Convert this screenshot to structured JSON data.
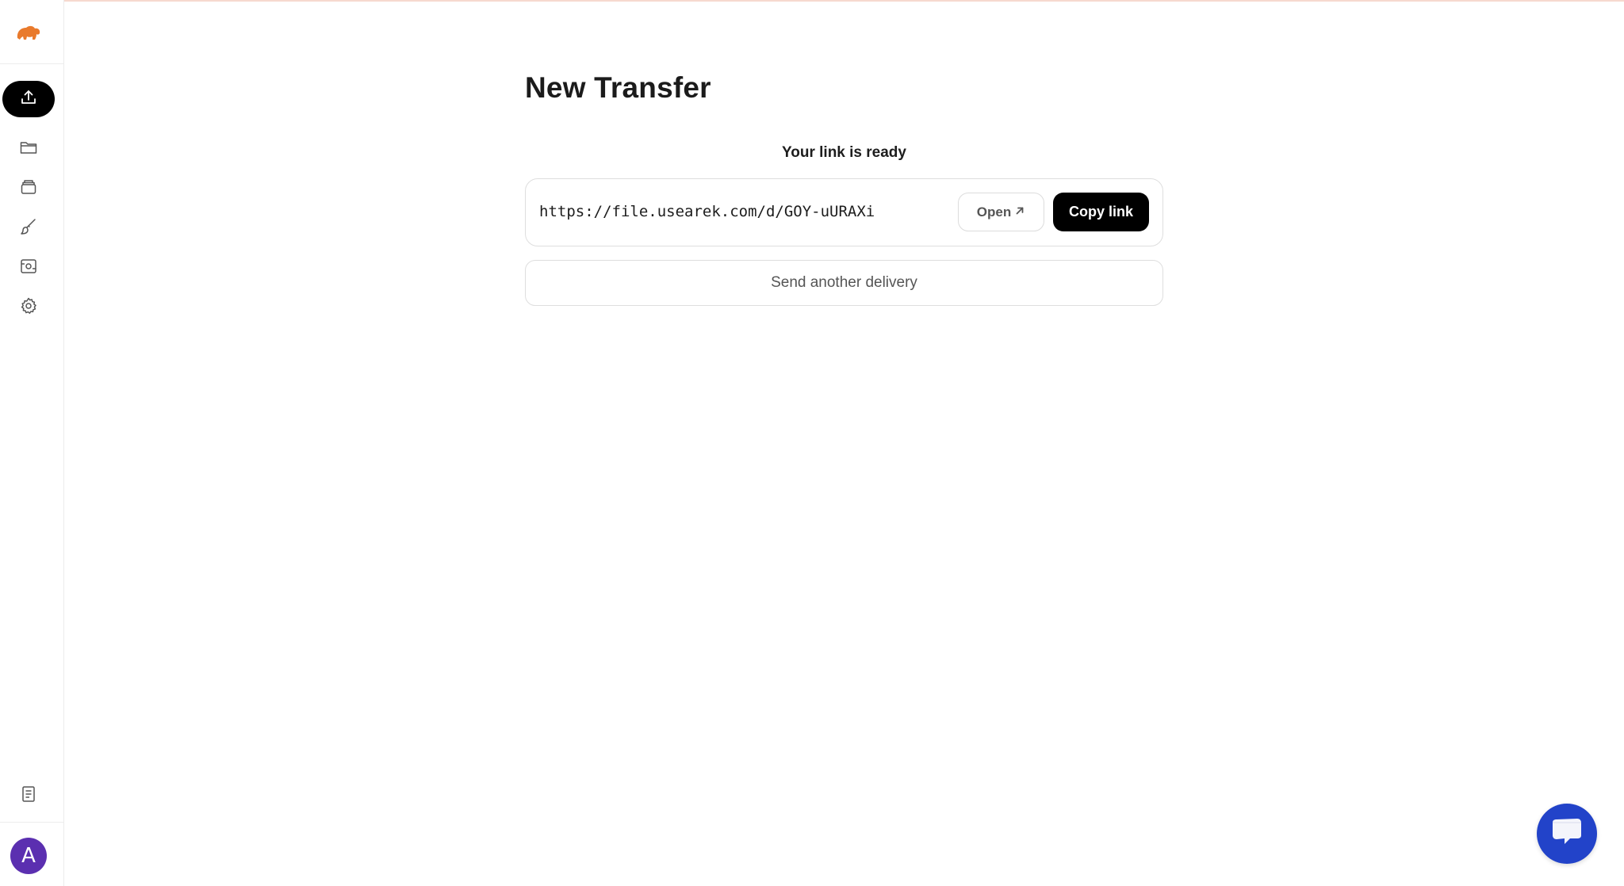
{
  "sidebar": {
    "logo": "elephant-logo",
    "items": [
      {
        "name": "upload",
        "icon": "upload-icon",
        "active": true
      },
      {
        "name": "files",
        "icon": "folder-icon"
      },
      {
        "name": "archive",
        "icon": "archive-icon"
      },
      {
        "name": "branding",
        "icon": "brush-icon"
      },
      {
        "name": "portal",
        "icon": "portal-icon"
      },
      {
        "name": "settings",
        "icon": "gear-icon"
      }
    ],
    "bottom_item": {
      "name": "docs",
      "icon": "document-icon"
    },
    "avatar_initial": "A",
    "avatar_color": "#5b2fb0"
  },
  "main": {
    "title": "New Transfer",
    "link_ready_label": "Your link is ready",
    "link_url": "https://file.usearek.com/d/GOY-uURAXi",
    "open_button": "Open",
    "copy_button": "Copy link",
    "send_another_button": "Send another delivery"
  },
  "colors": {
    "accent": "#000000",
    "logo": "#e97a2c",
    "chat": "#2243c9"
  },
  "chat_widget": {
    "icon": "chat-bubble-icon"
  }
}
